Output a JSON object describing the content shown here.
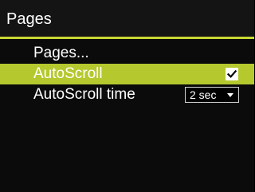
{
  "header": {
    "title": "Pages"
  },
  "menu": {
    "items": [
      {
        "label": "Pages..."
      },
      {
        "label": "AutoScroll",
        "checked": true,
        "selected": true
      },
      {
        "label": "AutoScroll time",
        "value": "2 sec"
      }
    ]
  },
  "colors": {
    "accent": "#c9d832",
    "selected_row": "#b5c82e",
    "background": "#000000"
  },
  "icons": {
    "check": "checkmark-icon",
    "dropdown": "chevron-down-icon"
  }
}
